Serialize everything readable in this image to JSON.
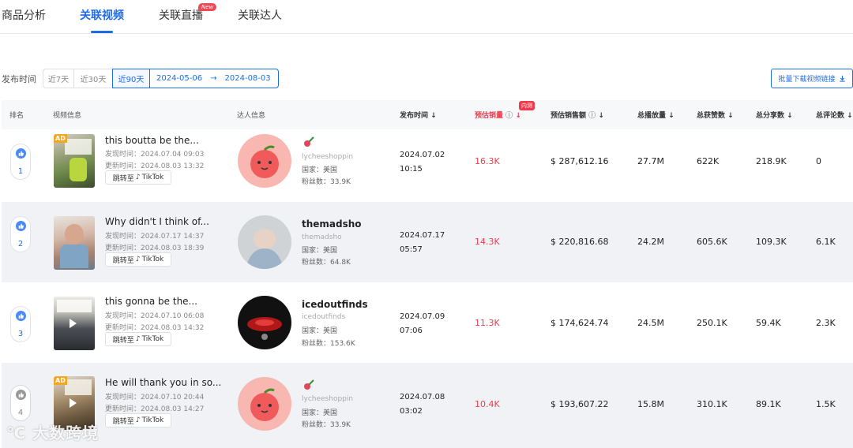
{
  "tabs": [
    {
      "label": "商品分析",
      "active": false
    },
    {
      "label": "关联视频",
      "active": true
    },
    {
      "label": "关联直播",
      "active": false,
      "badge": "New"
    },
    {
      "label": "关联达人",
      "active": false
    }
  ],
  "filter": {
    "label": "发布时间",
    "options": [
      "近7天",
      "近30天",
      "近90天"
    ],
    "selected": "近90天",
    "date_start": "2024-05-06",
    "date_sep": "→",
    "date_end": "2024-08-03"
  },
  "download_button": "批量下载视频链接",
  "columns": {
    "rank": "排名",
    "video": "视频信息",
    "creator": "达人信息",
    "publish": "发布时间",
    "sales": "预估销量",
    "sales_badge": "内测",
    "revenue": "预估销售额",
    "views": "总播放量",
    "likes": "总获赞数",
    "shares": "总分享数",
    "comments": "总评论数"
  },
  "jump_label": "跳转至",
  "tiktok_label": "TikTok",
  "rows": [
    {
      "rank": "1",
      "title": "this boutta be the...",
      "found": "发现时间：2024.07.04 09:03",
      "updated": "更新时间：2024.08.03 13:32",
      "creator_name": "",
      "creator_handle": "lycheeshoppin",
      "country": "国家：美国",
      "fans": "粉丝数：33.9K",
      "publish_date": "2024.07.02",
      "publish_time": "10:15",
      "sales": "16.3K",
      "revenue": "$ 287,612.16",
      "views": "27.7M",
      "likes": "622K",
      "shares": "218.9K",
      "comments": "0"
    },
    {
      "rank": "2",
      "title": "Why didn't I think of...",
      "found": "发现时间：2024.07.17 14:37",
      "updated": "更新时间：2024.08.03 18:39",
      "creator_name": "themadsho",
      "creator_handle": "themadsho",
      "country": "国家：美国",
      "fans": "粉丝数：64.8K",
      "publish_date": "2024.07.17",
      "publish_time": "05:57",
      "sales": "14.3K",
      "revenue": "$ 220,816.68",
      "views": "24.2M",
      "likes": "605.6K",
      "shares": "109.3K",
      "comments": "6.1K"
    },
    {
      "rank": "3",
      "title": "this gonna be the...",
      "found": "发现时间：2024.07.10 06:08",
      "updated": "更新时间：2024.08.03 14:32",
      "creator_name": "icedoutfinds",
      "creator_handle": "icedoutfinds",
      "country": "国家：美国",
      "fans": "粉丝数：153.6K",
      "publish_date": "2024.07.09",
      "publish_time": "07:06",
      "sales": "11.3K",
      "revenue": "$ 174,624.74",
      "views": "24.5M",
      "likes": "250.1K",
      "shares": "59.4K",
      "comments": "2.3K"
    },
    {
      "rank": "4",
      "title": "He will thank you in so...",
      "found": "发现时间：2024.07.10 20:44",
      "updated": "更新时间：2024.08.03 14:27",
      "creator_name": "",
      "creator_handle": "lycheeshoppin",
      "country": "国家：美国",
      "fans": "粉丝数：33.9K",
      "publish_date": "2024.07.08",
      "publish_time": "03:02",
      "sales": "10.4K",
      "revenue": "$ 193,607.22",
      "views": "15.8M",
      "likes": "310.1K",
      "shares": "89.1K",
      "comments": "1.5K"
    }
  ],
  "watermark": "大数跨境",
  "colors": {
    "accent": "#1e6ce8",
    "sales_red": "#ee3b4c",
    "alt_row": "#f1f2f6"
  }
}
